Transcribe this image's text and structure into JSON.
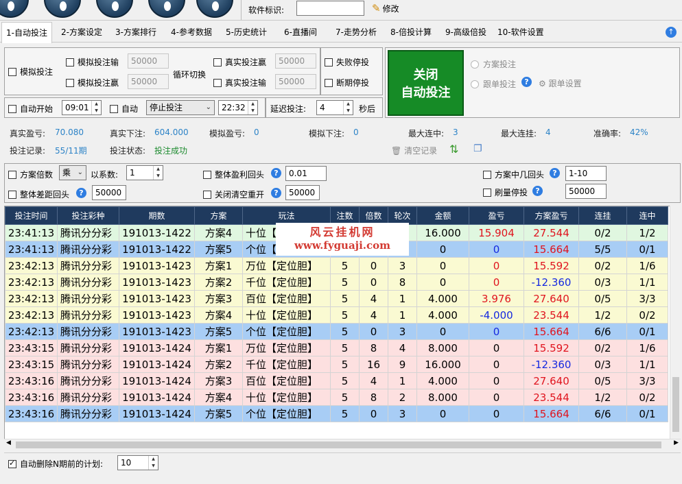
{
  "software_id": {
    "label": "软件标识:",
    "value": "",
    "edit_label": "修改"
  },
  "tabs": [
    "1-自动投注",
    "2-方案设定",
    "3-方案排行",
    "4-参考数据",
    "5-历史统计",
    "6-直播间",
    "7-走势分析",
    "8-倍投计算",
    "9-高级倍投",
    "10-软件设置"
  ],
  "controls": {
    "sim_bet": "模拟投注",
    "sim_loss": "模拟投注输",
    "sim_win": "模拟投注赢",
    "sim_loss_val": "50000",
    "sim_win_val": "50000",
    "cycle": "循环切换",
    "real_win": "真实投注赢",
    "real_loss": "真实投注输",
    "real_win_val": "50000",
    "real_loss_val": "50000",
    "fail_stop": "失败停投",
    "break_stop": "断期停投",
    "auto_start": "自动开始",
    "start_time": "09:01",
    "auto": "自动",
    "stop_select": "停止投注",
    "stop_time": "22:32",
    "delay_label": "延迟投注:",
    "delay_val": "4",
    "seconds": "秒后"
  },
  "big_button": {
    "line1": "关闭",
    "line2": "自动投注"
  },
  "radio": {
    "scheme": "方案投注",
    "follow": "跟单投注",
    "follow_settings": "跟单设置"
  },
  "stats": {
    "real_pl_label": "真实盈亏:",
    "real_pl": "70.080",
    "real_bet_label": "真实下注:",
    "real_bet": "604.000",
    "sim_pl_label": "模拟盈亏:",
    "sim_pl": "0",
    "sim_bet_label": "模拟下注:",
    "sim_bet": "0",
    "max_win_label": "最大连中:",
    "max_win": "3",
    "max_loss_label": "最大连挂:",
    "max_loss": "4",
    "acc_label": "准确率:",
    "acc": "42%",
    "record_label": "投注记录:",
    "record": "55/11期",
    "state_label": "投注状态:",
    "state": "投注成功",
    "clear": "清空记录"
  },
  "options": {
    "multiplier": "方案倍数",
    "mult_select": "乘",
    "coef_label": "以系数:",
    "coef_val": "1",
    "total_profit_back": "整体盈利回头",
    "total_profit_val": "0.01",
    "scheme_back": "方案中几回头",
    "scheme_back_val": "1-10",
    "total_diff_back": "整体差距回头",
    "total_diff_val": "50000",
    "close_clear": "关闭清空重开",
    "close_clear_val": "50000",
    "refresh_stop": "刷量停投",
    "refresh_stop_val": "50000"
  },
  "table": {
    "headers": [
      "投注时间",
      "投注彩种",
      "期数",
      "方案",
      "玩法",
      "注数",
      "倍数",
      "轮次",
      "金额",
      "盈亏",
      "方案盈亏",
      "连挂",
      "连中"
    ],
    "rows": [
      {
        "c": [
          "23:41:13",
          "腾讯分分彩",
          "191013-1422",
          "方案4",
          "十位【定位胆】",
          "5",
          "4",
          "7",
          "16.000",
          "15.904",
          "27.544",
          "0/2",
          "1/2"
        ],
        "cls": "green",
        "pl": "red",
        "spl": "red"
      },
      {
        "c": [
          "23:41:13",
          "腾讯分分彩",
          "191013-1422",
          "方案5",
          "个位【定位胆】",
          "5",
          "0",
          "3",
          "0",
          "0",
          "15.664",
          "5/5",
          "0/1"
        ],
        "cls": "blue",
        "pl": "blu",
        "spl": "red"
      },
      {
        "c": [
          "23:42:13",
          "腾讯分分彩",
          "191013-1423",
          "方案1",
          "万位【定位胆】",
          "5",
          "0",
          "3",
          "0",
          "0",
          "15.592",
          "0/2",
          "1/6"
        ],
        "cls": "yellow",
        "pl": "red",
        "spl": "red"
      },
      {
        "c": [
          "23:42:13",
          "腾讯分分彩",
          "191013-1423",
          "方案2",
          "千位【定位胆】",
          "5",
          "0",
          "8",
          "0",
          "0",
          "-12.360",
          "0/3",
          "1/1"
        ],
        "cls": "yellow",
        "pl": "red",
        "spl": "blu"
      },
      {
        "c": [
          "23:42:13",
          "腾讯分分彩",
          "191013-1423",
          "方案3",
          "百位【定位胆】",
          "5",
          "4",
          "1",
          "4.000",
          "3.976",
          "27.640",
          "0/5",
          "3/3"
        ],
        "cls": "yellow",
        "pl": "red",
        "spl": "red"
      },
      {
        "c": [
          "23:42:13",
          "腾讯分分彩",
          "191013-1423",
          "方案4",
          "十位【定位胆】",
          "5",
          "4",
          "1",
          "4.000",
          "-4.000",
          "23.544",
          "1/2",
          "0/2"
        ],
        "cls": "yellow",
        "pl": "blu",
        "spl": "red"
      },
      {
        "c": [
          "23:42:13",
          "腾讯分分彩",
          "191013-1423",
          "方案5",
          "个位【定位胆】",
          "5",
          "0",
          "3",
          "0",
          "0",
          "15.664",
          "6/6",
          "0/1"
        ],
        "cls": "blue",
        "pl": "blu",
        "spl": "red"
      },
      {
        "c": [
          "23:43:15",
          "腾讯分分彩",
          "191013-1424",
          "方案1",
          "万位【定位胆】",
          "5",
          "8",
          "4",
          "8.000",
          "0",
          "15.592",
          "0/2",
          "1/6"
        ],
        "cls": "pink",
        "pl": "",
        "spl": "red"
      },
      {
        "c": [
          "23:43:15",
          "腾讯分分彩",
          "191013-1424",
          "方案2",
          "千位【定位胆】",
          "5",
          "16",
          "9",
          "16.000",
          "0",
          "-12.360",
          "0/3",
          "1/1"
        ],
        "cls": "pink",
        "pl": "",
        "spl": "blu"
      },
      {
        "c": [
          "23:43:16",
          "腾讯分分彩",
          "191013-1424",
          "方案3",
          "百位【定位胆】",
          "5",
          "4",
          "1",
          "4.000",
          "0",
          "27.640",
          "0/5",
          "3/3"
        ],
        "cls": "pink",
        "pl": "",
        "spl": "red"
      },
      {
        "c": [
          "23:43:16",
          "腾讯分分彩",
          "191013-1424",
          "方案4",
          "十位【定位胆】",
          "5",
          "8",
          "2",
          "8.000",
          "0",
          "23.544",
          "1/2",
          "0/2"
        ],
        "cls": "pink",
        "pl": "",
        "spl": "red"
      },
      {
        "c": [
          "23:43:16",
          "腾讯分分彩",
          "191013-1424",
          "方案5",
          "个位【定位胆】",
          "5",
          "0",
          "3",
          "0",
          "0",
          "15.664",
          "6/6",
          "0/1"
        ],
        "cls": "blue",
        "pl": "",
        "spl": "red"
      }
    ]
  },
  "watermark": {
    "line1": "风云挂机网",
    "line2": "www.fyguaji.com"
  },
  "footer": {
    "auto_delete": "自动删除N期前的计划:",
    "n_val": "10"
  }
}
